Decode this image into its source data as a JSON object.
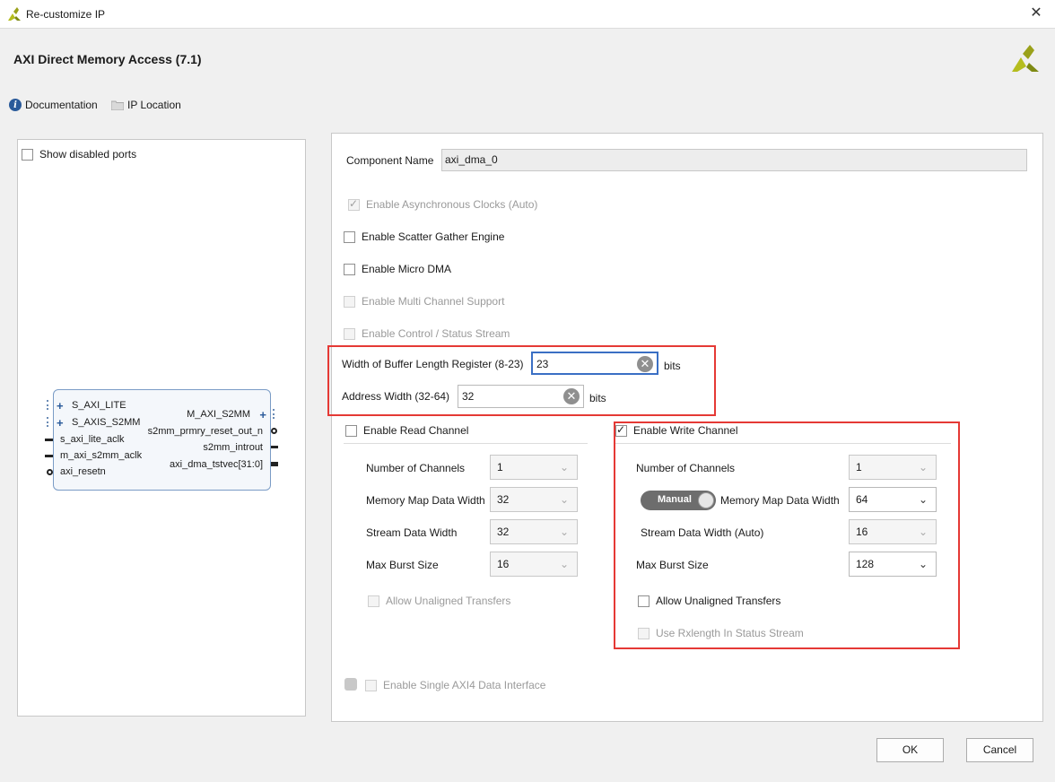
{
  "window": {
    "title": "Re-customize IP",
    "close_icon": "close-icon"
  },
  "header": {
    "title": "AXI Direct Memory Access (7.1)"
  },
  "toolbar": {
    "documentation": "Documentation",
    "ip_location": "IP Location"
  },
  "left_panel": {
    "show_disabled_ports": "Show disabled ports",
    "block": {
      "left_ports": [
        "S_AXI_LITE",
        "S_AXIS_S2MM",
        "s_axi_lite_aclk",
        "m_axi_s2mm_aclk",
        "axi_resetn"
      ],
      "right_ports": [
        "M_AXI_S2MM",
        "s2mm_prmry_reset_out_n",
        "s2mm_introut",
        "axi_dma_tstvec[31:0]"
      ]
    }
  },
  "form": {
    "component_name_label": "Component Name",
    "component_name_value": "axi_dma_0",
    "enable_async_clocks": "Enable Asynchronous Clocks (Auto)",
    "enable_scatter_gather": "Enable Scatter Gather Engine",
    "enable_micro_dma": "Enable Micro DMA",
    "enable_multi_channel": "Enable Multi Channel Support",
    "enable_control_status": "Enable Control / Status Stream",
    "buffer_length_label": "Width of Buffer Length Register (8-23)",
    "buffer_length_value": "23",
    "buffer_length_unit": "bits",
    "address_width_label": "Address Width (32-64)",
    "address_width_value": "32",
    "address_width_unit": "bits",
    "enable_single_axi4": "Enable Single AXI4 Data Interface"
  },
  "read_channel": {
    "label": "Enable Read Channel",
    "checked": false,
    "num_channels_label": "Number of Channels",
    "num_channels_value": "1",
    "mm_data_width_label": "Memory Map Data Width",
    "mm_data_width_value": "32",
    "stream_data_width_label": "Stream Data Width",
    "stream_data_width_value": "32",
    "max_burst_label": "Max Burst Size",
    "max_burst_value": "16",
    "allow_unaligned": "Allow Unaligned Transfers"
  },
  "write_channel": {
    "label": "Enable Write Channel",
    "checked": true,
    "num_channels_label": "Number of Channels",
    "num_channels_value": "1",
    "manual_toggle": "Manual",
    "mm_data_width_label": "Memory Map Data Width",
    "mm_data_width_value": "64",
    "stream_data_width_label": "Stream Data Width (Auto)",
    "stream_data_width_value": "16",
    "max_burst_label": "Max Burst Size",
    "max_burst_value": "128",
    "allow_unaligned": "Allow Unaligned Transfers",
    "use_rxlength": "Use Rxlength In Status Stream"
  },
  "footer": {
    "ok": "OK",
    "cancel": "Cancel"
  },
  "colors": {
    "highlight_box": "#e53935",
    "info_icon": "#2a5a9a",
    "logo": "#b5bd1e"
  }
}
